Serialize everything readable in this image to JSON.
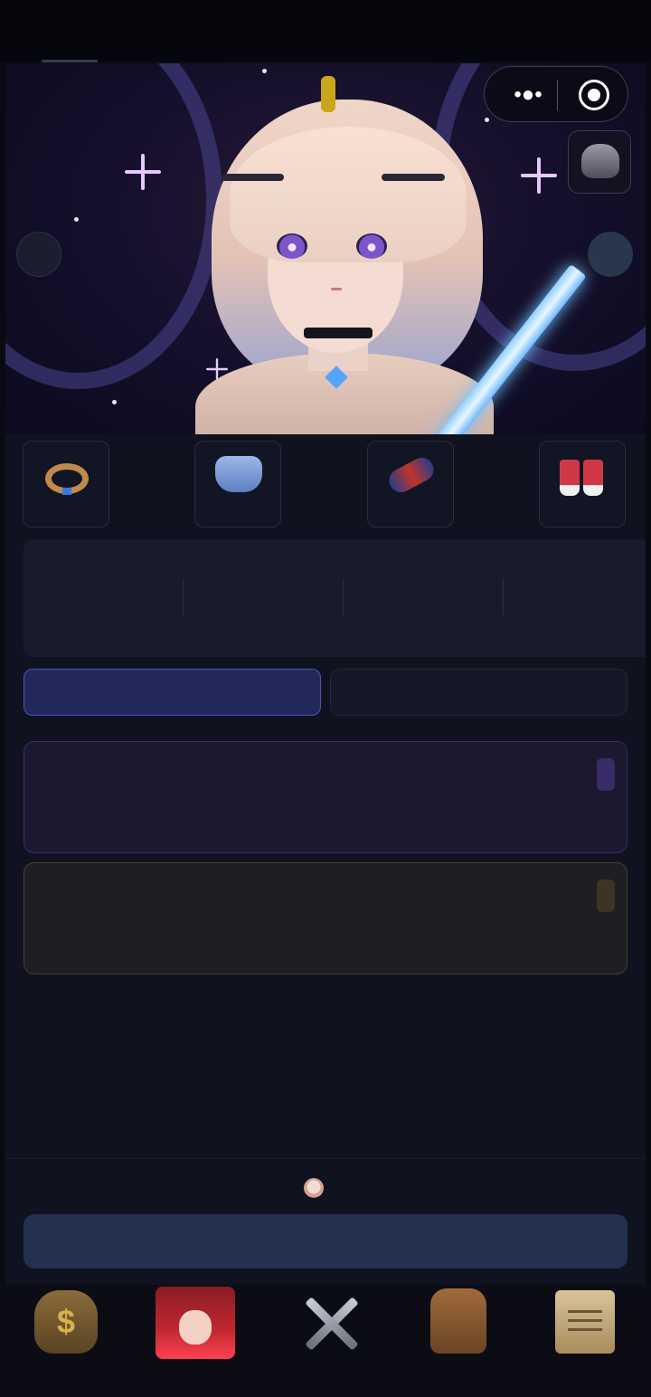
{
  "header": {
    "capsule_more_glyph": "•●•",
    "capsule_target_icon": "target-icon"
  },
  "hero": {
    "portrait": "pixel-art-portrait-blonde-swordswoman",
    "top_indicator_color": "#c9a61c",
    "side_buttons": [
      "arrow-left-button",
      "arrow-right-button"
    ],
    "corner_button_icon": "helmet-icon"
  },
  "equipment": {
    "slots": [
      {
        "icon": "ring-icon"
      },
      {
        "icon": "chest-armor-icon"
      },
      {
        "icon": "gauntlet-icon"
      },
      {
        "icon": "boots-icon"
      }
    ]
  },
  "tabs": [
    {
      "state": "active"
    },
    {
      "state": "inactive"
    }
  ],
  "cards": [
    {
      "accent": "#3b2f66"
    },
    {
      "accent": "#4a3e2a"
    }
  ],
  "colors": {
    "background": "#10121f",
    "primary_button": "#23314e",
    "active_tab": "#23285a"
  },
  "bottom_nav": {
    "items": [
      {
        "icon": "money-bag-icon",
        "glyph": "$"
      },
      {
        "icon": "hero-portrait-icon",
        "selected": true
      },
      {
        "icon": "crossed-swords-icon"
      },
      {
        "icon": "backpack-icon"
      },
      {
        "icon": "scroll-icon"
      }
    ]
  }
}
